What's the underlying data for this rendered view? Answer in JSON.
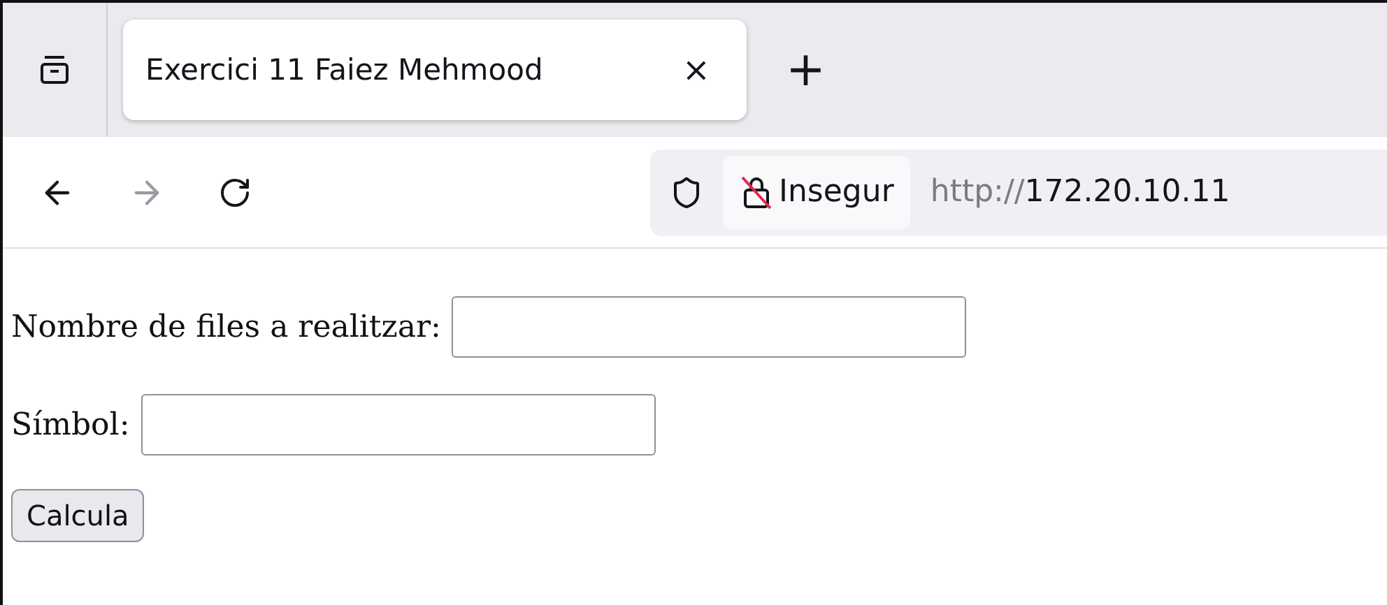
{
  "tabs": [
    {
      "title": "Exercici 11 Faiez Mehmood",
      "close": "×",
      "selected": true
    }
  ],
  "new_tab": "+",
  "address_bar": {
    "security_label": "Insegur",
    "url_scheme": "http://",
    "url_host": "172.20.10.11"
  },
  "form": {
    "fields": [
      {
        "label": "Nombre de files a realitzar:"
      },
      {
        "label": "Símbol:"
      }
    ],
    "submit": "Calcula"
  }
}
